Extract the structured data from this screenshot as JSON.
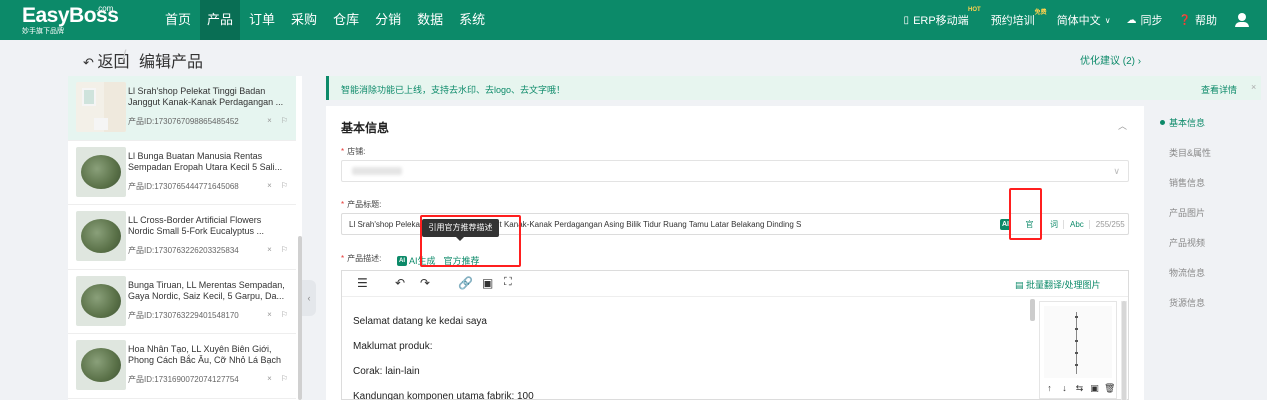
{
  "brand": {
    "logo": "EasyBoss",
    "logo_com": ".com",
    "slogan": "妙手旗下品牌"
  },
  "nav": [
    "首页",
    "产品",
    "订单",
    "采购",
    "仓库",
    "分销",
    "数据",
    "系统"
  ],
  "nav_active": "产品",
  "topright": {
    "erp": "ERP移动端",
    "erp_badge": "HOT",
    "training": "预约培训",
    "training_badge": "免费",
    "language": "简体中文",
    "sync": "同步",
    "help": "帮助"
  },
  "header": {
    "back": "返回",
    "separator": "/",
    "title": "编辑产品",
    "suggestion": "优化建议 (2)"
  },
  "product_list": [
    {
      "name": "Ll Srah'shop Pelekat Tinggi Badan Janggut Kanak-Kanak Perdagangan ...",
      "id": "产品ID:1730767098865485452",
      "active": true
    },
    {
      "name": "Ll Bunga Buatan Manusia Rentas Sempadan Eropah Utara Kecil 5 Sali...",
      "id": "产品ID:1730765444771645068",
      "active": false
    },
    {
      "name": "LL Cross-Border Artificial Flowers Nordic Small 5-Fork Eucalyptus ...",
      "id": "产品ID:1730763226203325834",
      "active": false
    },
    {
      "name": "Bunga Tiruan, LL Merentas Sempadan, Gaya Nordic, Saiz Kecil, 5 Garpu, Da...",
      "id": "产品ID:1730763229401548170",
      "active": false
    },
    {
      "name": "Hoa Nhân Tạo, LL Xuyên Biên Giới, Phong Cách Bắc Âu, Cỡ Nhỏ Lá Bạch ...",
      "id": "产品ID:1731690072074127754",
      "active": false
    }
  ],
  "list_actions": {
    "close": "×",
    "flag": "⚐"
  },
  "banner": {
    "text": "智能消除功能已上线，支持去水印、去logo、去文字哦！",
    "link": "查看详情",
    "close": "×"
  },
  "basic_info": {
    "title": "基本信息",
    "store_label": "店铺:",
    "product_title_label": "产品标题:",
    "product_title_value": "Ll Srah'shop Pelekat Tinggi Badan Janggut Kanak-Kanak Perdagangan Asing Bilik Tidur Ruang Tamu Latar Belakang Dinding S",
    "title_tools": {
      "ai": "AI",
      "guan": "官",
      "ci": "词",
      "abc": "Abc",
      "count": "255/255"
    },
    "tooltip": "引用官方推荐描述",
    "desc_label": "产品描述:",
    "desc_ai": "AI生成",
    "desc_official": "官方推荐",
    "batch_translate": "批量翻译/处理图片",
    "desc_lines": [
      "Selamat datang ke kedai saya",
      "Maklumat produk:",
      "Corak: lain-lain",
      "Kandungan komponen utama fabrik: 100"
    ]
  },
  "right_nav": [
    "基本信息",
    "类目&属性",
    "销售信息",
    "产品图片",
    "产品视频",
    "物流信息",
    "货源信息"
  ],
  "colors": {
    "brand": "#0c8a69",
    "highlight": "#ff1f1f"
  }
}
